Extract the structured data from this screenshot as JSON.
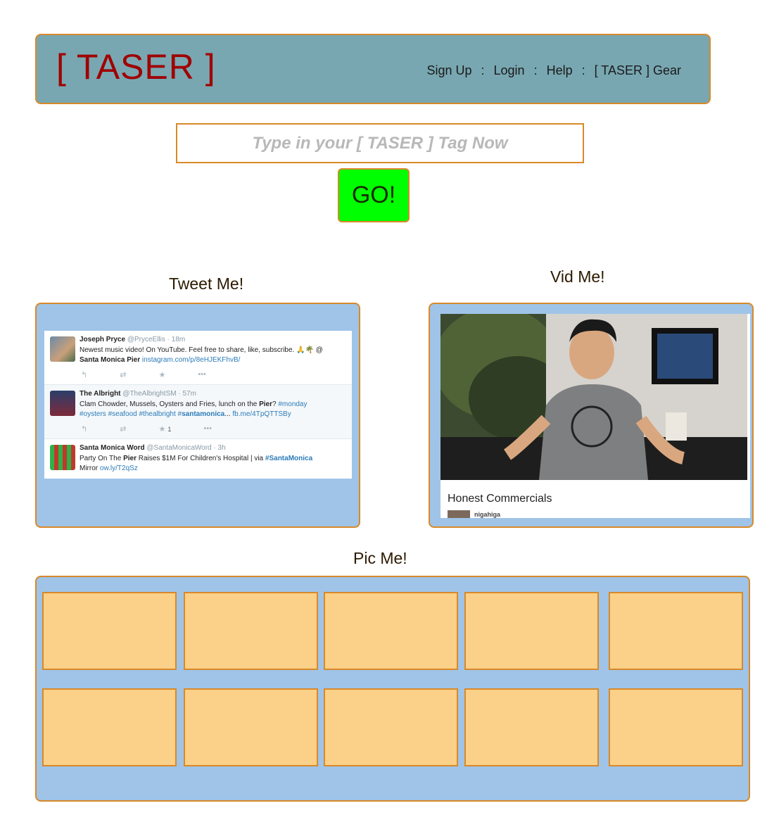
{
  "header": {
    "logo": "[ TASER ]",
    "nav": [
      "Sign Up",
      "Login",
      "Help",
      "[ TASER ] Gear"
    ],
    "separator": ":"
  },
  "search": {
    "placeholder": "Type in your [ TASER ] Tag Now",
    "value": "",
    "go_label": "GO!"
  },
  "tweet_section": {
    "title": "Tweet Me!",
    "tweets": [
      {
        "name": "Joseph Pryce",
        "handle": "@PryceEllis · 18m",
        "text_pre": "Newest music video! On YouTube. Feel free to share, like, subscribe. 🙏🌴 @",
        "place": "Santa Monica Pier",
        "link": "instagram.com/p/8eHJEKFhvB/",
        "actions": [
          "↰",
          "⇄",
          "★",
          "•••"
        ]
      },
      {
        "name": "The Albright",
        "handle": "@TheAlbrightSM · 57m",
        "text_pre": "Clam Chowder, Mussels, Oysters and Fries, lunch on the",
        "bold": "Pier",
        "text_mid": "?",
        "hash1": "#monday",
        "hash2": "#oysters #seafood #thealbright #",
        "bold2": "santamonica",
        "text_end": "...",
        "link": "fb.me/4TpQTTSBy",
        "actions": [
          "↰",
          "⇄",
          "★",
          "1",
          "•••"
        ]
      },
      {
        "name": "Santa Monica Word",
        "handle": "@SantaMonicaWord · 3h",
        "text_pre": "Party On The",
        "bold": "Pier",
        "text_mid": "Raises $1M For Children's Hospital | via",
        "hash1": "#SantaMonica",
        "text_end": "Mirror",
        "link": "ow.ly/T2qSz"
      }
    ]
  },
  "video_section": {
    "title": "Vid Me!",
    "video_title": "Honest Commercials",
    "channel": "nigahiga"
  },
  "pic_section": {
    "title": "Pic Me!",
    "tiles": 10
  },
  "colors": {
    "header_bg": "#78a7b1",
    "border": "#d8892a",
    "panel_bg": "#9fc4e8",
    "tile_bg": "#fbd088",
    "go_bg": "#00ff00",
    "logo": "#a00000"
  }
}
